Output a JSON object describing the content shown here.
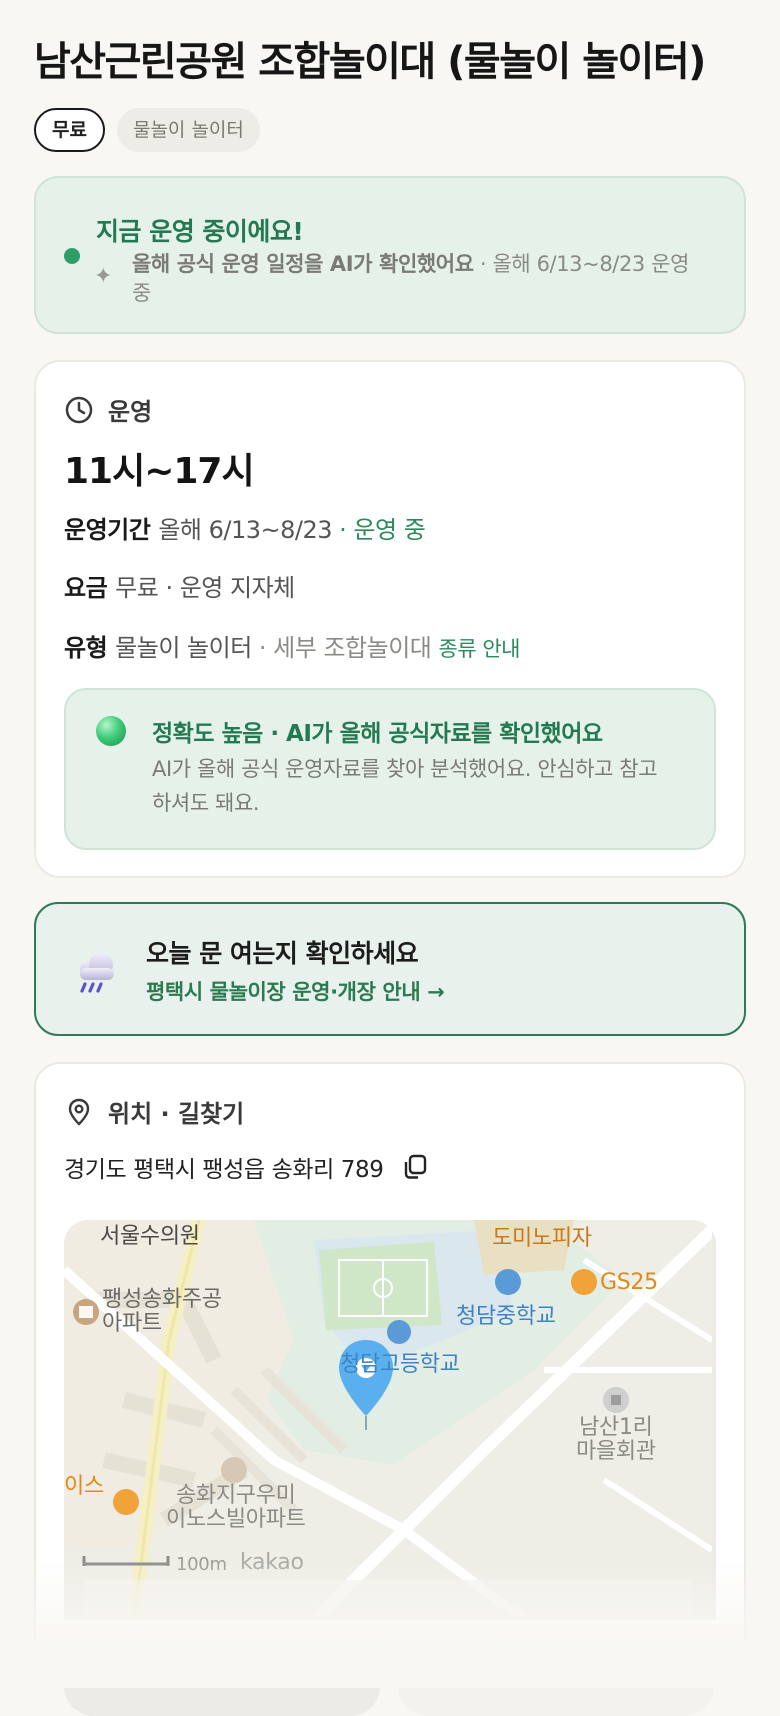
{
  "title": "남산근린공원 조합놀이대 (물놀이 놀이터)",
  "tags": {
    "fee": "무료",
    "type": "물놀이 놀이터"
  },
  "status": {
    "title": "지금 운영 중이에요!",
    "verified": "올해 공식 운영 일정을 AI가 확인했어요",
    "period": "· 올해 6/13~8/23 운영 중"
  },
  "operation": {
    "heading": "운영",
    "hours": "11시~17시",
    "period_label": "운영기간",
    "period_value": "올해 6/13~8/23",
    "period_status": "· 운영 중",
    "fee_label": "요금",
    "fee_value": "무료 · 운영 지자체",
    "type_label": "유형",
    "type_value": "물놀이 놀이터",
    "type_detail": "· 세부 조합놀이대",
    "type_link": "종류 안내",
    "accuracy_title": "정확도 높음 · AI가 올해 공식자료를 확인했어요",
    "accuracy_text": "AI가 올해 공식 운영자료를 찾아 분석했어요. 안심하고 참고하셔도 돼요."
  },
  "weather": {
    "title": "오늘 문 여는지 확인하세요",
    "link": "평택시 물놀이장 운영·개장 안내 →"
  },
  "location": {
    "heading": "위치 · 길찾기",
    "address": "경기도 평택시 팽성읍 송화리 789",
    "map_labels": {
      "clinic": "서울수의원",
      "pizza": "도미노피자",
      "gs25": "GS25",
      "middle_school": "청담중학교",
      "apartment1_line1": "팽성송화주공",
      "apartment1_line2": "아파트",
      "high_school": "청담고등학교",
      "village_hall_line1": "남산1리",
      "village_hall_line2": "마을회관",
      "cafe": "이스",
      "apartment2_line1": "송화지구우미",
      "apartment2_line2": "이노스빌아파트",
      "scale": "100m",
      "provider": "kakao"
    }
  }
}
